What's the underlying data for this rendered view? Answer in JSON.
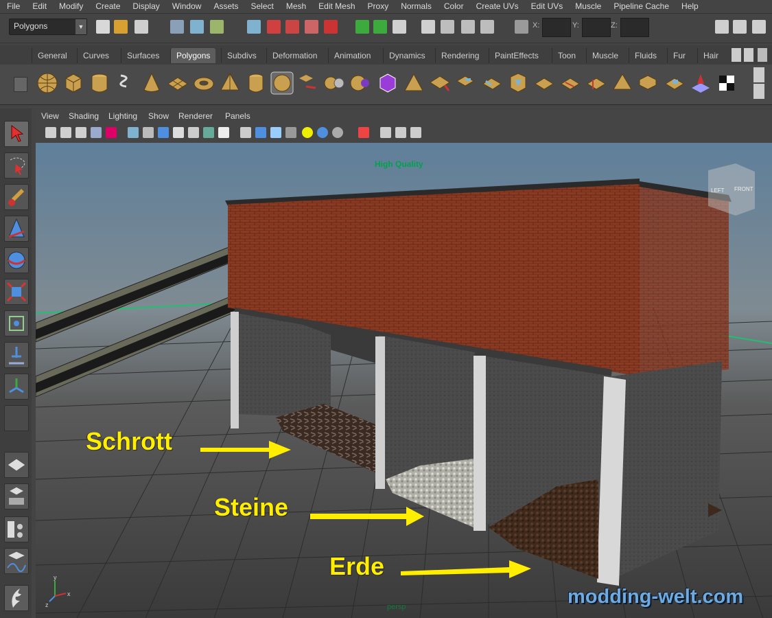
{
  "menubar": [
    "File",
    "Edit",
    "Modify",
    "Create",
    "Display",
    "Window",
    "Assets",
    "Select",
    "Mesh",
    "Edit Mesh",
    "Proxy",
    "Normals",
    "Color",
    "Create UVs",
    "Edit UVs",
    "Muscle",
    "Pipeline Cache",
    "Help"
  ],
  "statusline": {
    "mode": "Polygons",
    "x_label": "X:",
    "y_label": "Y:",
    "z_label": "Z:"
  },
  "shelf_tabs": [
    "General",
    "Curves",
    "Surfaces",
    "Polygons",
    "Subdivs",
    "Deformation",
    "Animation",
    "Dynamics",
    "Rendering",
    "PaintEffects",
    "Toon",
    "Muscle",
    "Fluids",
    "Fur",
    "Hair"
  ],
  "active_shelf_tab": "Polygons",
  "panel_menu": [
    "View",
    "Shading",
    "Lighting",
    "Show",
    "Renderer",
    "Panels"
  ],
  "viewport": {
    "render_mode": "High Quality",
    "camera": "persp",
    "viewcube_labels": [
      "LEFT",
      "FRONT"
    ],
    "axis_labels": [
      "y",
      "x",
      "z"
    ]
  },
  "callouts": [
    "Schrott",
    "Steine",
    "Erde"
  ],
  "watermark": "modding-welt.com",
  "colors": {
    "ui_background": "#444444",
    "viewport_bg_top": "#5f7f9a",
    "viewport_bg_bottom": "#3e3e3e",
    "callout_color": "#ffee00",
    "render_mode_color": "#00a24b",
    "watermark_color": "#6fa9df"
  }
}
